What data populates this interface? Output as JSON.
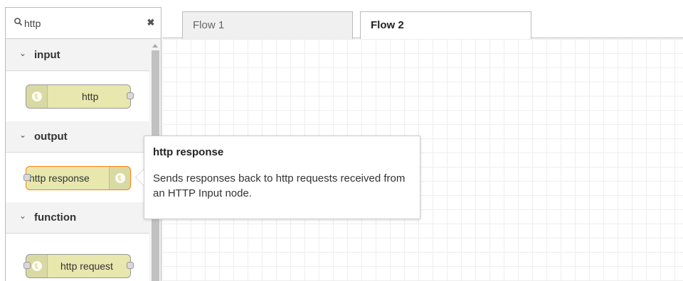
{
  "search": {
    "value": "http",
    "icon": "search-icon",
    "clear_icon": "close-icon",
    "clear_glyph": "✖"
  },
  "categories": [
    {
      "label": "input",
      "chevron": "⌄",
      "nodes": [
        {
          "label": "http",
          "color": "#e7e7ae",
          "icon": "globe-icon"
        }
      ]
    },
    {
      "label": "output",
      "chevron": "⌄",
      "nodes": [
        {
          "label": "http response",
          "color": "#e7e7ae",
          "icon": "globe-icon",
          "selected": true
        }
      ]
    },
    {
      "label": "function",
      "chevron": "⌄",
      "nodes": [
        {
          "label": "http request",
          "color": "#e7e7ae",
          "icon": "globe-icon"
        }
      ]
    }
  ],
  "tabs": [
    {
      "label": "Flow 1",
      "active": false
    },
    {
      "label": "Flow 2",
      "active": true
    }
  ],
  "tooltip": {
    "title": "http response",
    "body": "Sends responses back to http requests received from an HTTP Input node."
  },
  "colors": {
    "node_fill": "#e7e7ae",
    "selection": "#ff7f0e",
    "grid": "#eeeeee"
  }
}
